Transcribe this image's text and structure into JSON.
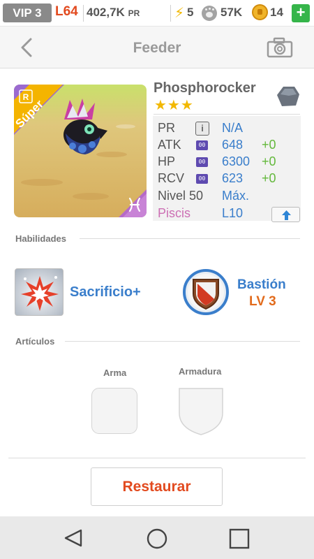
{
  "status_bar": {
    "vip": "VIP 3",
    "level": "L64",
    "exp": "402,7K",
    "exp_unit": "PR",
    "energy": "5",
    "food": "57K",
    "gems": "14",
    "add_label": "+"
  },
  "nav": {
    "title": "Feeder"
  },
  "monster": {
    "name": "Phosphorocker",
    "stars": "★★★",
    "rank_badge": "R",
    "tier_ribbon": "Súper",
    "stats": {
      "pr": {
        "label": "PR",
        "value": "N/A"
      },
      "atk": {
        "label": "ATK",
        "chip": "00",
        "value": "648",
        "bonus": "+0"
      },
      "hp": {
        "label": "HP",
        "chip": "00",
        "value": "6300",
        "bonus": "+0"
      },
      "rcv": {
        "label": "RCV",
        "chip": "00",
        "value": "623",
        "bonus": "+0"
      }
    },
    "level_label": "Nivel 50",
    "level_value": "Máx.",
    "sign_label": "Piscis",
    "sign_value": "L10"
  },
  "abilities": {
    "section_title": "Habilidades",
    "active_name": "Sacrificio+",
    "passive_name": "Bastión",
    "passive_level": "LV 3"
  },
  "items": {
    "section_title": "Artículos",
    "weapon_label": "Arma",
    "armor_label": "Armadura"
  },
  "restore_label": "Restaurar",
  "colors": {
    "accent_blue": "#3a7ecb",
    "accent_orange": "#e24a1f",
    "bonus_green": "#63b83b",
    "sign_pink": "#cc6fb4",
    "star_gold": "#f2b800"
  }
}
